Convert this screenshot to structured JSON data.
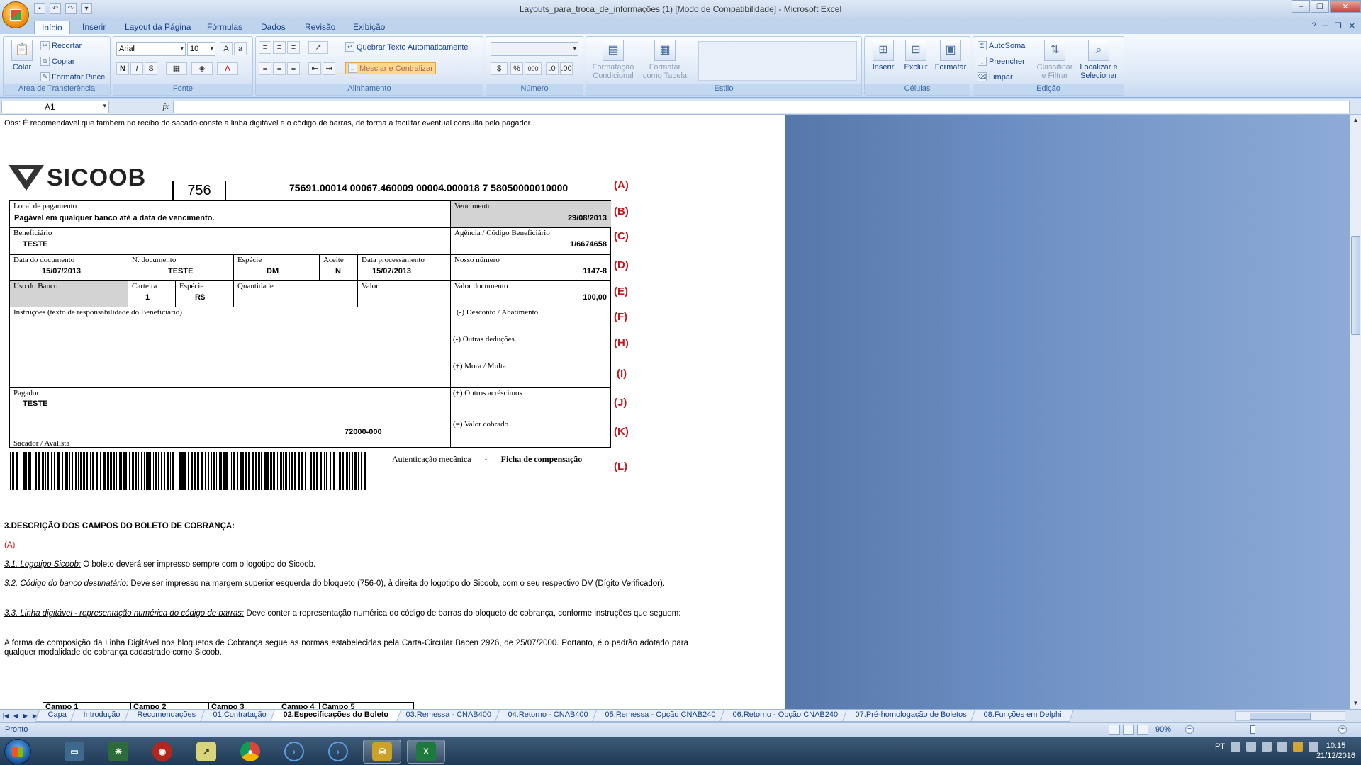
{
  "window": {
    "title": "Layouts_para_troca_de_informações (1)  [Modo de Compatibilidade] - Microsoft Excel"
  },
  "ribbon_tabs": [
    "Início",
    "Inserir",
    "Layout da Página",
    "Fórmulas",
    "Dados",
    "Revisão",
    "Exibição"
  ],
  "clipboard": {
    "paste": "Colar",
    "cut": "Recortar",
    "copy": "Copiar",
    "format_painter": "Formatar Pincel",
    "title": "Área de Transferência"
  },
  "font": {
    "name": "Arial",
    "size": "10",
    "title": "Fonte",
    "bold": "N",
    "italic": "I",
    "underline": "S"
  },
  "alignment": {
    "wrap": "Quebrar Texto Automaticamente",
    "merge": "Mesclar e Centralizar",
    "title": "Alinhamento"
  },
  "number": {
    "title": "Número",
    "percent": "%",
    "thousands": "000"
  },
  "style": {
    "conditional": "Formatação Condicional",
    "as_table": "Formatar como Tabela",
    "title": "Estilo"
  },
  "cells": {
    "insert": "Inserir",
    "delete": "Excluir",
    "format": "Formatar",
    "title": "Células"
  },
  "editing": {
    "autosum": "AutoSoma",
    "fill": "Preencher",
    "clear": "Limpar",
    "sort": "Classificar e Filtrar",
    "find": "Localizar e Selecionar",
    "title": "Edição"
  },
  "formula_bar": {
    "name_box": "A1",
    "fx": "fx",
    "value": ""
  },
  "sheet": {
    "obs": "Obs: É recomendável que também no recibo do sacado conste a linha digitável e o código de barras, de forma a facilitar eventual consulta pelo pagador.",
    "logo": "SICOOB",
    "bank_code": "756",
    "digitable_line": "75691.00014 00067.460009 00004.000018 7 58050000010000",
    "markers": [
      "(A)",
      "(B)",
      "(C)",
      "(D)",
      "(E)",
      "(F)",
      "(H)",
      "(I)",
      "(J)",
      "(K)",
      "(L)"
    ],
    "boleto": {
      "local_label": "Local de pagamento",
      "local_value": "Pagável em qualquer banco até a data de vencimento.",
      "venc_label": "Vencimento",
      "venc_value": "29/08/2013",
      "benef_label": "Beneficiário",
      "benef_value": "TESTE",
      "agencia_label": "Agência / Código Beneficiário",
      "agencia_value": "1/6674658",
      "data_doc_label": "Data do documento",
      "data_doc_value": "15/07/2013",
      "ndoc_label": "N. documento",
      "ndoc_value": "TESTE",
      "especie_label": "Espécie",
      "especie_value": "DM",
      "aceite_label": "Aceite",
      "aceite_value": "N",
      "data_proc_label": "Data processamento",
      "data_proc_value": "15/07/2013",
      "nosso_label": "Nosso número",
      "nosso_value": "1147-8",
      "uso_label": "Uso do Banco",
      "carteira_label": "Carteira",
      "carteira_value": "1",
      "especie2_label": "Espécie",
      "especie2_value": "R$",
      "quantidade_label": "Quantidade",
      "valor_label": "Valor",
      "valor_doc_label": "Valor documento",
      "valor_doc_value": "100,00",
      "instrucoes_label": "Instruções (texto de responsabilidade do Beneficiário)",
      "desconto_label": "(-) Desconto / Abatimento",
      "outras_ded_label": "(-) Outras deduções",
      "mora_label": "(+) Mora / Multa",
      "outros_acr_label": "(+) Outros acréscimos",
      "valor_cobrado_label": "(=) Valor cobrado",
      "pagador_label": "Pagador",
      "pagador_value": "TESTE",
      "cep_value": "72000-000",
      "sacador_label": "Sacador / Avalista",
      "autenticacao": "Autenticação mecânica",
      "dash": "-",
      "ficha": "Ficha de compensação"
    },
    "section_title": "3.DESCRIÇÃO DOS CAMPOS DO BOLETO DE COBRANÇA:",
    "sub_a": "(A)",
    "p31_title": "3.1. Logotipo Sicoob:",
    "p31_text": " O boleto deverá ser impresso sempre com o logotipo do Sicoob.",
    "p32_title": "3.2. Código do banco destinatário:",
    "p32_text": " Deve ser impresso na margem superior esquerda do bloqueto (756-0), à direita do logotipo do Sicoob, com o seu respectivo DV (Dígito Verificador).",
    "p33_title": "3.3. Linha digitável - representação numérica do código de barras:",
    "p33_text": " Deve conter a representação numérica do código de barras do bloqueto de cobrança, conforme instruções que seguem:",
    "p34_text": "A forma de composição da Linha Digitável nos bloquetos de Cobrança segue as normas estabelecidas pela Carta-Circular Bacen 2926, de 25/07/2000. Portanto, é o padrão adotado para qualquer modalidade de cobrança cadastrado como Sicoob.",
    "campos": [
      "Campo 1",
      "Campo 2",
      "Campo 3",
      "Campo 4",
      "Campo 5"
    ]
  },
  "sheet_tabs": [
    "Capa",
    "Introdução",
    "Recomendações",
    "01.Contratação",
    "02.Especificações do Boleto",
    "03.Remessa - CNAB400",
    "04.Retorno - CNAB400",
    "05.Remessa - Opção CNAB240",
    "06.Retorno - Opção CNAB240",
    "07.Pré-homologação de Boletos",
    "08.Funções em Delphi"
  ],
  "status": {
    "text": "Pronto",
    "zoom": "90%"
  },
  "taskbar": {
    "lang": "PT",
    "time": "10:15",
    "date": "21/12/2016"
  }
}
